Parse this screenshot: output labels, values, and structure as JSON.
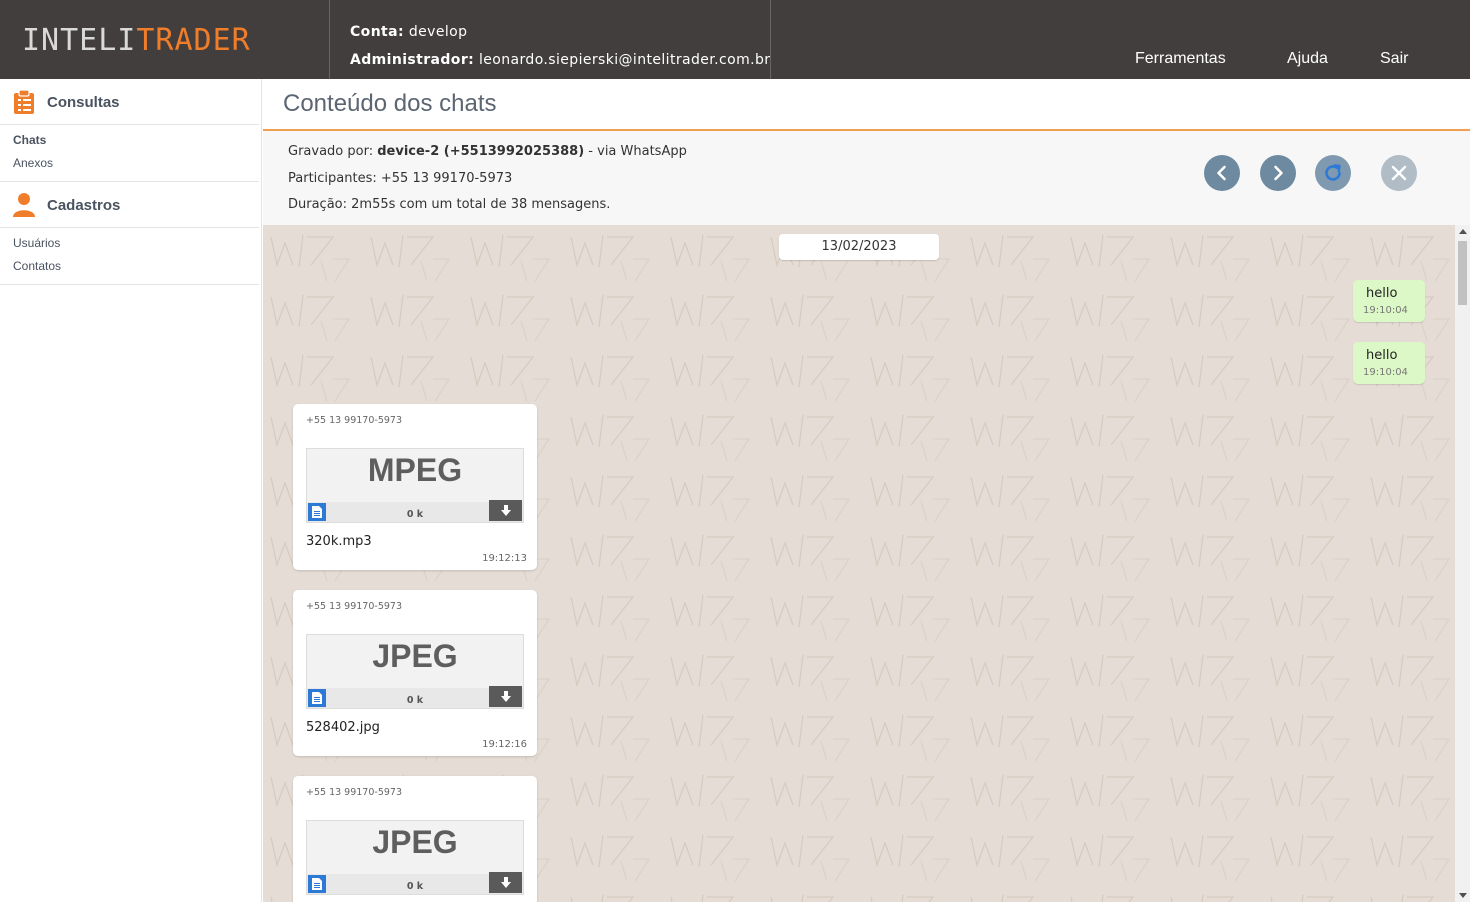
{
  "logo": {
    "part1": "INTELI",
    "part2": "TRADER"
  },
  "account": {
    "conta_label": "Conta:",
    "conta_value": "develop",
    "admin_label": "Administrador:",
    "admin_value": "leonardo.siepierski@intelitrader.com.br"
  },
  "topnav": {
    "tools": "Ferramentas",
    "help": "Ajuda",
    "exit": "Sair"
  },
  "sidebar": {
    "consultas": {
      "title": "Consultas",
      "items": [
        "Chats",
        "Anexos"
      ]
    },
    "cadastros": {
      "title": "Cadastros",
      "items": [
        "Usuários",
        "Contatos"
      ]
    }
  },
  "page": {
    "title": "Conteúdo dos chats"
  },
  "info": {
    "recorded_label": "Gravado por:",
    "recorded_device": "device-2 (+5513992025388)",
    "recorded_via": "- via WhatsApp",
    "participants_label": "Participantes:",
    "participants_value": "+55 13 99170-5973",
    "duration_label": "Duração:",
    "duration_value": "2m55s com um total de 38 mensagens."
  },
  "chat": {
    "date": "13/02/2023",
    "outgoing": [
      {
        "text": "hello",
        "time": "19:10:04"
      },
      {
        "text": "hello",
        "time": "19:10:04"
      }
    ],
    "attachments": [
      {
        "sender": "+55 13 99170-5973",
        "ext": "MPEG",
        "size": "0 k",
        "filename": "320k.mp3",
        "time": "19:12:13"
      },
      {
        "sender": "+55 13 99170-5973",
        "ext": "JPEG",
        "size": "0 k",
        "filename": "528402.jpg",
        "time": "19:12:16"
      },
      {
        "sender": "+55 13 99170-5973",
        "ext": "JPEG",
        "size": "0 k",
        "filename": "",
        "time": ""
      }
    ]
  },
  "colors": {
    "header_bg": "#423e3d",
    "accent": "#f07d2a",
    "chat_bg": "#e5ddd5",
    "outgoing_bubble": "#dcf8c6",
    "nav_button": "#6d8aa1",
    "close_button": "#b0bcc6"
  }
}
